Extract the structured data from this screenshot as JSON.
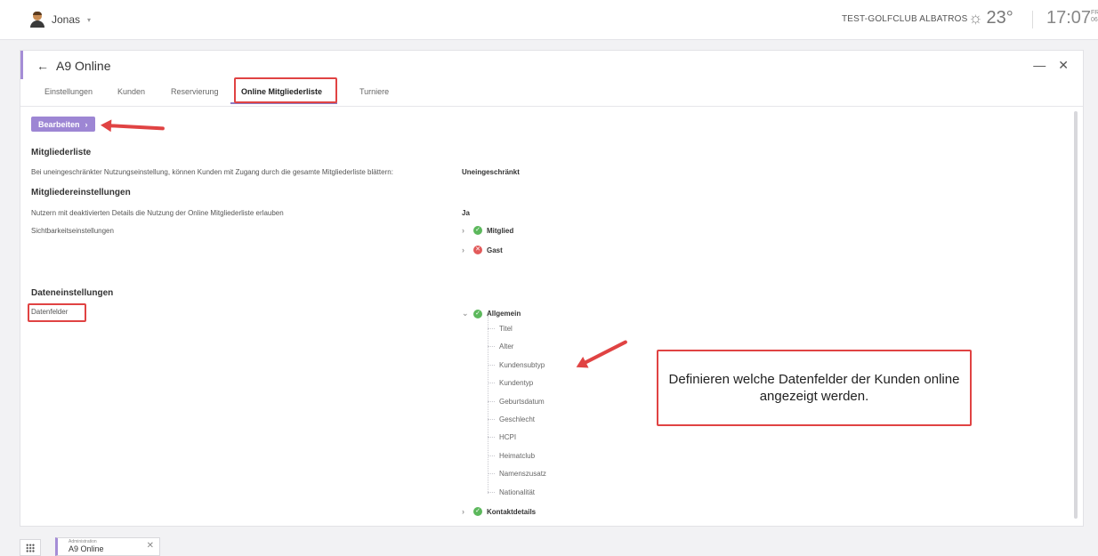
{
  "topbar": {
    "user_name": "Jonas",
    "club_name": "TEST-GOLFCLUB ALBATROS",
    "temperature": "23°",
    "time": "17:07",
    "date_line1": "FRE",
    "date_line2": "06.0"
  },
  "panel": {
    "title": "A9 Online",
    "tabs": [
      {
        "label": "Einstellungen"
      },
      {
        "label": "Kunden"
      },
      {
        "label": "Reservierung"
      },
      {
        "label": "Online Mitgliederliste"
      },
      {
        "label": "Turniere"
      }
    ],
    "active_tab": "Online Mitgliederliste"
  },
  "content": {
    "edit_button": "Bearbeiten",
    "members_section": "Mitgliederliste",
    "members_desc": "Bei uneingeschränkter Nutzungseinstellung, können Kunden mit Zugang durch die gesamte Mitgliederliste blättern:",
    "members_value": "Uneingeschränkt",
    "member_settings_section": "Mitgliedereinstellungen",
    "deactivated_label": "Nutzern mit deaktivierten Details die Nutzung der Online Mitgliederliste erlauben",
    "deactivated_value": "Ja",
    "visibility_label": "Sichtbarkeitseinstellungen",
    "visibility_items": [
      "Mitglied",
      "Gast"
    ],
    "data_settings_section": "Dateneinstellungen",
    "data_fields_label": "Datenfelder",
    "general_group": "Allgemein",
    "general_fields": [
      "Titel",
      "Alter",
      "Kundensubtyp",
      "Kundentyp",
      "Geburtsdatum",
      "Geschlecht",
      "HCPI",
      "Heimatclub",
      "Namenszusatz",
      "Nationalität"
    ],
    "contact_group": "Kontaktdetails",
    "callout_text": "Definieren welche Datenfelder der Kunden online angezeigt werden."
  },
  "taskbar": {
    "task_category": "Administration",
    "task_title": "A9 Online"
  },
  "colors": {
    "accent": "#a58dd6",
    "button": "#9d86d4",
    "annotation_red": "#e04343",
    "ok_green": "#5cb85c",
    "denied_red": "#e25a5a"
  }
}
